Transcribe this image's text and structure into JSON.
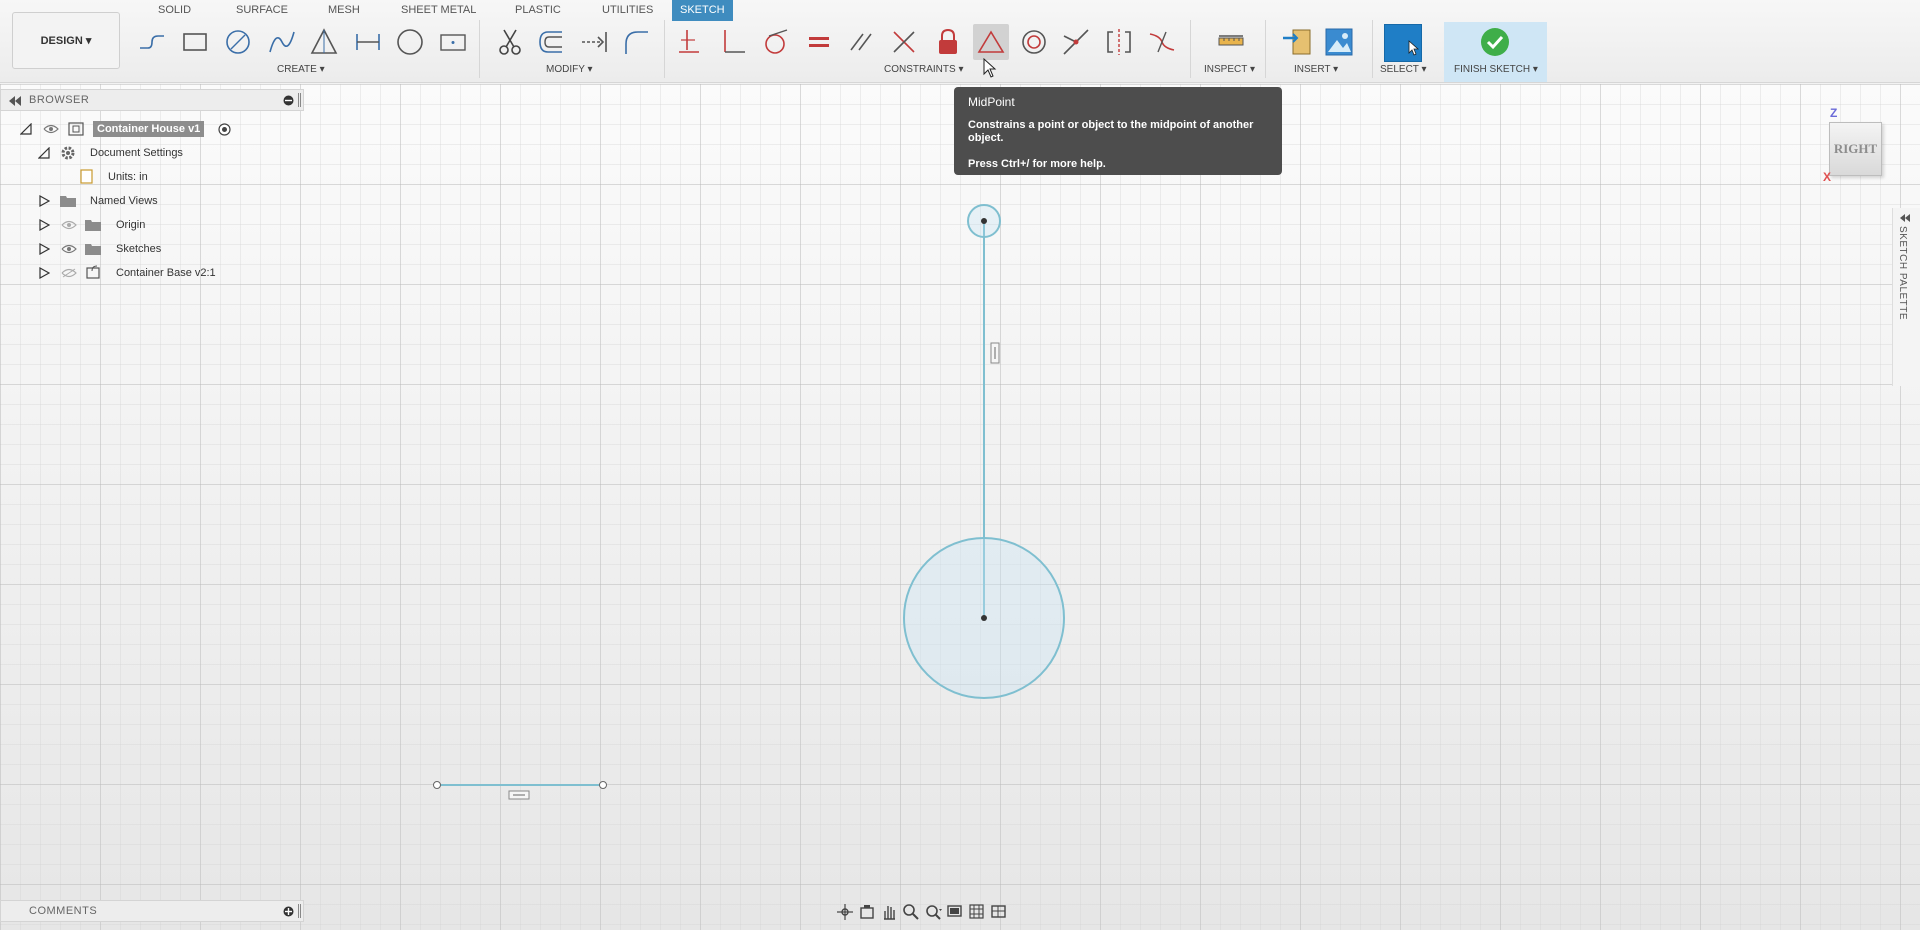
{
  "workspace_button": "DESIGN ▾",
  "tabs": [
    {
      "label": "SOLID",
      "active": false
    },
    {
      "label": "SURFACE",
      "active": false
    },
    {
      "label": "MESH",
      "active": false
    },
    {
      "label": "SHEET METAL",
      "active": false
    },
    {
      "label": "PLASTIC",
      "active": false
    },
    {
      "label": "UTILITIES",
      "active": false
    },
    {
      "label": "SKETCH",
      "active": true
    }
  ],
  "groups": {
    "create": "CREATE ▾",
    "modify": "MODIFY ▾",
    "constraints": "CONSTRAINTS ▾",
    "inspect": "INSPECT ▾",
    "insert": "INSERT ▾",
    "select": "SELECT ▾",
    "finish_sketch": "FINISH SKETCH ▾"
  },
  "browser": {
    "title": "BROWSER",
    "root": "Container House v1",
    "items": [
      {
        "label": "Document Settings"
      },
      {
        "label": "Units: in"
      },
      {
        "label": "Named Views"
      },
      {
        "label": "Origin"
      },
      {
        "label": "Sketches"
      },
      {
        "label": "Container Base v2:1"
      }
    ]
  },
  "tooltip": {
    "title": "MidPoint",
    "body": "Constrains a point or object to the midpoint of another object.",
    "help": "Press Ctrl+/ for more help."
  },
  "viewcube": {
    "face": "RIGHT",
    "axis_z": "Z",
    "axis_x": "X"
  },
  "palette_label": "SKETCH PALETTE",
  "comments": {
    "title": "COMMENTS"
  },
  "colors": {
    "accent": "#3f8cbf",
    "sketch_line": "#7fbfd0",
    "tooltip_bg": "#4d4d4d"
  }
}
